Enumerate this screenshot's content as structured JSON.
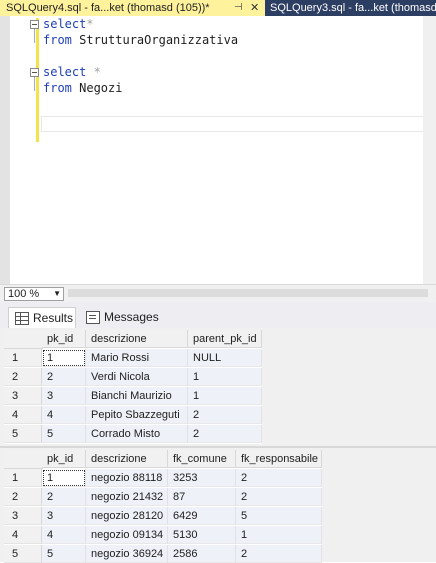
{
  "tabs": [
    {
      "label": "SQLQuery4.sql - fa...ket (thomasd (105))*",
      "active": true
    },
    {
      "label": "SQLQuery3.sql - fa...ket (thomasd",
      "active": false
    }
  ],
  "editor": {
    "lines": [
      {
        "kw": "select",
        "rest": "*"
      },
      {
        "kw": "from",
        "rest": " StrutturaOrganizzativa"
      },
      {
        "kw": "",
        "rest": ""
      },
      {
        "kw": "select",
        "rest": " *"
      },
      {
        "kw": "from",
        "rest": " Negozi"
      }
    ]
  },
  "zoom": {
    "value": "100 %"
  },
  "result_tabs": {
    "results": "Results",
    "messages": "Messages"
  },
  "grid1": {
    "columns": [
      "pk_id",
      "descrizione",
      "parent_pk_id"
    ],
    "rows": [
      {
        "n": "1",
        "c": [
          "1",
          "Mario Rossi",
          "NULL"
        ]
      },
      {
        "n": "2",
        "c": [
          "2",
          "Verdi Nicola",
          "1"
        ]
      },
      {
        "n": "3",
        "c": [
          "3",
          "Bianchi Maurizio",
          "1"
        ]
      },
      {
        "n": "4",
        "c": [
          "4",
          "Pepito Sbazzeguti",
          "2"
        ]
      },
      {
        "n": "5",
        "c": [
          "5",
          "Corrado Misto",
          "2"
        ]
      }
    ]
  },
  "grid2": {
    "columns": [
      "pk_id",
      "descrizione",
      "fk_comune",
      "fk_responsabile"
    ],
    "rows": [
      {
        "n": "1",
        "c": [
          "1",
          "negozio 88118",
          "3253",
          "2"
        ]
      },
      {
        "n": "2",
        "c": [
          "2",
          "negozio 21432",
          "87",
          "2"
        ]
      },
      {
        "n": "3",
        "c": [
          "3",
          "negozio 28120",
          "6429",
          "5"
        ]
      },
      {
        "n": "4",
        "c": [
          "4",
          "negozio 09134",
          "5130",
          "1"
        ]
      },
      {
        "n": "5",
        "c": [
          "5",
          "negozio 36924",
          "2586",
          "2"
        ]
      }
    ]
  }
}
